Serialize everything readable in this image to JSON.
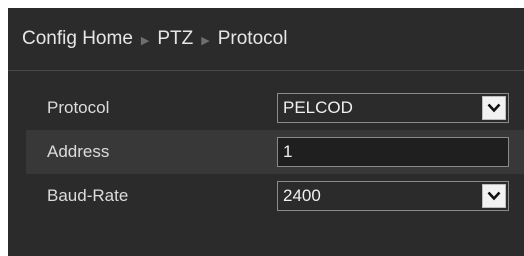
{
  "breadcrumb": {
    "home": "Config Home",
    "section": "PTZ",
    "page": "Protocol",
    "separator_icon": "triangle-right-icon"
  },
  "form": {
    "protocol": {
      "label": "Protocol",
      "value": "PELCOD",
      "control": "select"
    },
    "address": {
      "label": "Address",
      "value": "1",
      "control": "text"
    },
    "baud_rate": {
      "label": "Baud-Rate",
      "value": "2400",
      "control": "select"
    }
  },
  "colors": {
    "panel_bg": "#2b2b2b",
    "row_highlight": "#383838",
    "text": "#e6e6e6",
    "field_border": "#8a8a8a"
  }
}
